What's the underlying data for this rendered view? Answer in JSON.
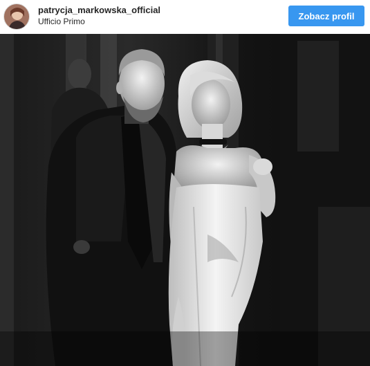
{
  "post": {
    "username": "patrycja_markowska_official",
    "location": "Ufficio Primo",
    "profile_button_label": "Zobacz profil",
    "avatar_icon": "profile-avatar",
    "image_alt": "Black and white photo of a man in a dark suit and a woman in a white strapless dress"
  },
  "colors": {
    "button_bg": "#3897f0",
    "button_text": "#ffffff",
    "text_primary": "#262626",
    "header_bg": "#ffffff"
  }
}
